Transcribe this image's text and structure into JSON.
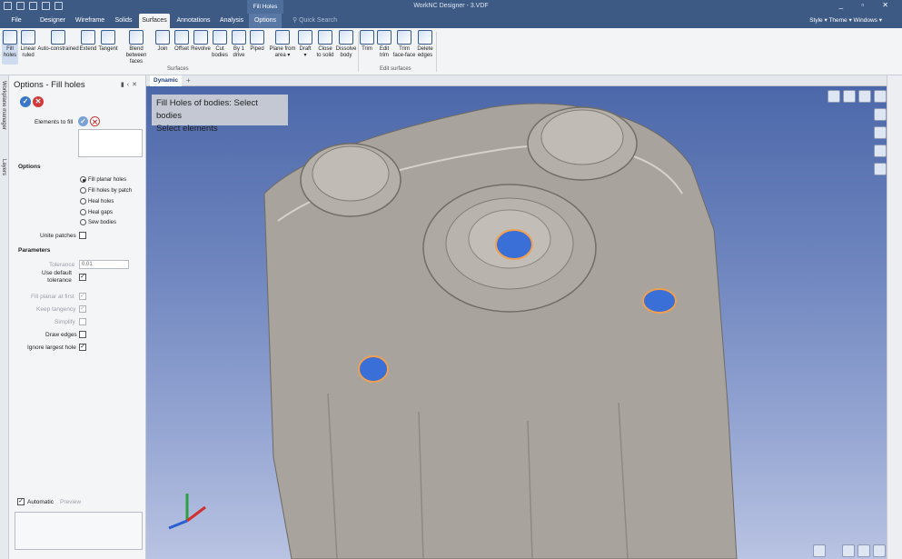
{
  "window": {
    "title": "WorkNC Designer - 3.VDF",
    "context_tab": "Fill Holes",
    "controls": "_ ▫ ✕"
  },
  "tabs": [
    {
      "label": "File"
    },
    {
      "label": "Designer"
    },
    {
      "label": "Wireframe"
    },
    {
      "label": "Solids"
    },
    {
      "label": "Surfaces"
    },
    {
      "label": "Annotations"
    },
    {
      "label": "Analysis"
    },
    {
      "label": "Options"
    }
  ],
  "quick_search": {
    "placeholder": "Quick Search"
  },
  "right_menus": {
    "style": "Style",
    "theme": "Theme",
    "windows": "Windows"
  },
  "ribbon": {
    "surfaces_buttons": [
      {
        "label": "Fill\nholes",
        "icon": "fill-holes-icon"
      },
      {
        "label": "Linear\nruled",
        "icon": "linear-ruled-icon"
      },
      {
        "label": "Auto-constrained",
        "icon": "auto-constrained-icon"
      },
      {
        "label": "Extend",
        "icon": "extend-icon"
      },
      {
        "label": "Tangent",
        "icon": "tangent-icon"
      },
      {
        "label": "Blend\nbetween faces",
        "icon": "blend-icon"
      },
      {
        "label": "Join",
        "icon": "join-icon"
      },
      {
        "label": "Offset",
        "icon": "offset-icon"
      },
      {
        "label": "Revolve",
        "icon": "revolve-icon"
      },
      {
        "label": "Cut\nbodies",
        "icon": "cut-bodies-icon"
      },
      {
        "label": "By 1\ndrive",
        "icon": "by1drive-icon"
      },
      {
        "label": "Piped",
        "icon": "piped-icon"
      },
      {
        "label": "Plane from\narea ▾",
        "icon": "plane-from-area-icon"
      },
      {
        "label": "Draft\n▾",
        "icon": "draft-icon"
      },
      {
        "label": "Close\nto solid",
        "icon": "close-to-solid-icon"
      },
      {
        "label": "Dissolve\nbody",
        "icon": "dissolve-body-icon"
      }
    ],
    "edit_buttons": [
      {
        "label": "Trim",
        "icon": "trim-icon"
      },
      {
        "label": "Edit\ntrim",
        "icon": "edit-trim-icon"
      },
      {
        "label": "Trim\nface-face",
        "icon": "trim-face-face-icon"
      },
      {
        "label": "Delete\nedges",
        "icon": "delete-edges-icon"
      }
    ],
    "group_surfaces": "Surfaces",
    "group_edit": "Edit surfaces"
  },
  "side_tabs": {
    "workplane": "Workplane manager",
    "layers": "Layers"
  },
  "panel": {
    "title": "Options - Fill holes",
    "elements_label": "Elements to fill",
    "options_header": "Options",
    "radios": [
      {
        "label": "Fill planar holes",
        "checked": true
      },
      {
        "label": "Fill holes by patch",
        "checked": false
      },
      {
        "label": "Heal holes",
        "checked": false
      },
      {
        "label": "Heal gaps",
        "checked": false
      },
      {
        "label": "Sew bodies",
        "checked": false
      }
    ],
    "unite_patches": "Unite patches",
    "parameters_header": "Parameters",
    "tolerance_label": "Tolerance",
    "tolerance_value": "0.01",
    "use_default_tolerance": "Use default\ntolerance",
    "fill_planar_first": "Fill planar at first",
    "keep_tangency": "Keep tangency",
    "simplify": "Simplify",
    "draw_edges": "Draw edges",
    "ignore_largest": "Ignore largest hole",
    "automatic": "Automatic",
    "preview": "Preview"
  },
  "viewport": {
    "tab": "Dynamic",
    "prompt_line1": "Fill Holes of bodies: Select bodies",
    "prompt_line2": "Select elements",
    "colors": {
      "hole_blue": "#3a6fd8",
      "hole_edge": "#f0a050",
      "part_gray": "#a8a39c"
    }
  }
}
